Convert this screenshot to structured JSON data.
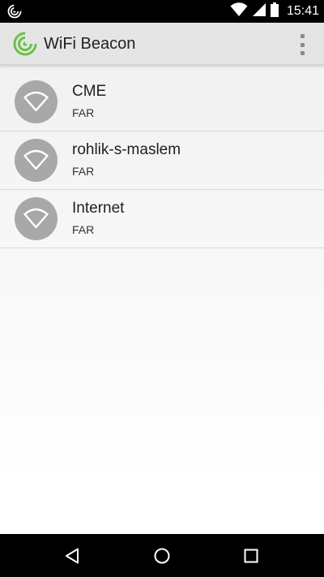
{
  "status_bar": {
    "time": "15:41",
    "icons": [
      "app-notification-icon",
      "wifi-signal-icon",
      "cell-signal-icon",
      "battery-icon"
    ]
  },
  "app_bar": {
    "title": "WiFi Beacon",
    "logo": "radar-logo-icon",
    "menu_icon": "overflow-menu-icon",
    "accent": "#6cc04a"
  },
  "networks": [
    {
      "name": "CME",
      "proximity": "FAR"
    },
    {
      "name": "rohlik-s-maslem",
      "proximity": "FAR"
    },
    {
      "name": "Internet",
      "proximity": "FAR"
    }
  ],
  "nav_bar": {
    "icons": [
      "back-icon",
      "home-icon",
      "recents-icon"
    ]
  }
}
